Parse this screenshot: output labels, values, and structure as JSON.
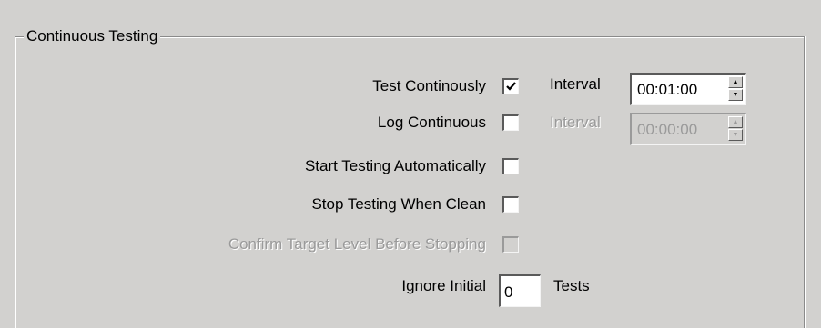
{
  "group": {
    "title": "Continuous Testing"
  },
  "rows": {
    "test_continuously": {
      "label": "Test Continously",
      "checked": true,
      "interval_label": "Interval",
      "interval_value": "00:01:00"
    },
    "log_continuous": {
      "label": "Log Continuous",
      "checked": false,
      "interval_label": "Interval",
      "interval_value": "00:00:00"
    },
    "start_auto": {
      "label": "Start Testing Automatically",
      "checked": false
    },
    "stop_clean": {
      "label": "Stop Testing  When Clean",
      "checked": false
    },
    "confirm_target": {
      "label": "Confirm Target Level Before Stopping",
      "checked": false
    },
    "ignore_initial": {
      "label": "Ignore Initial",
      "value": "0",
      "suffix": "Tests"
    }
  },
  "icons": {
    "spin_up": "up-arrow-icon",
    "spin_down": "down-arrow-icon",
    "check": "checkmark-icon"
  }
}
